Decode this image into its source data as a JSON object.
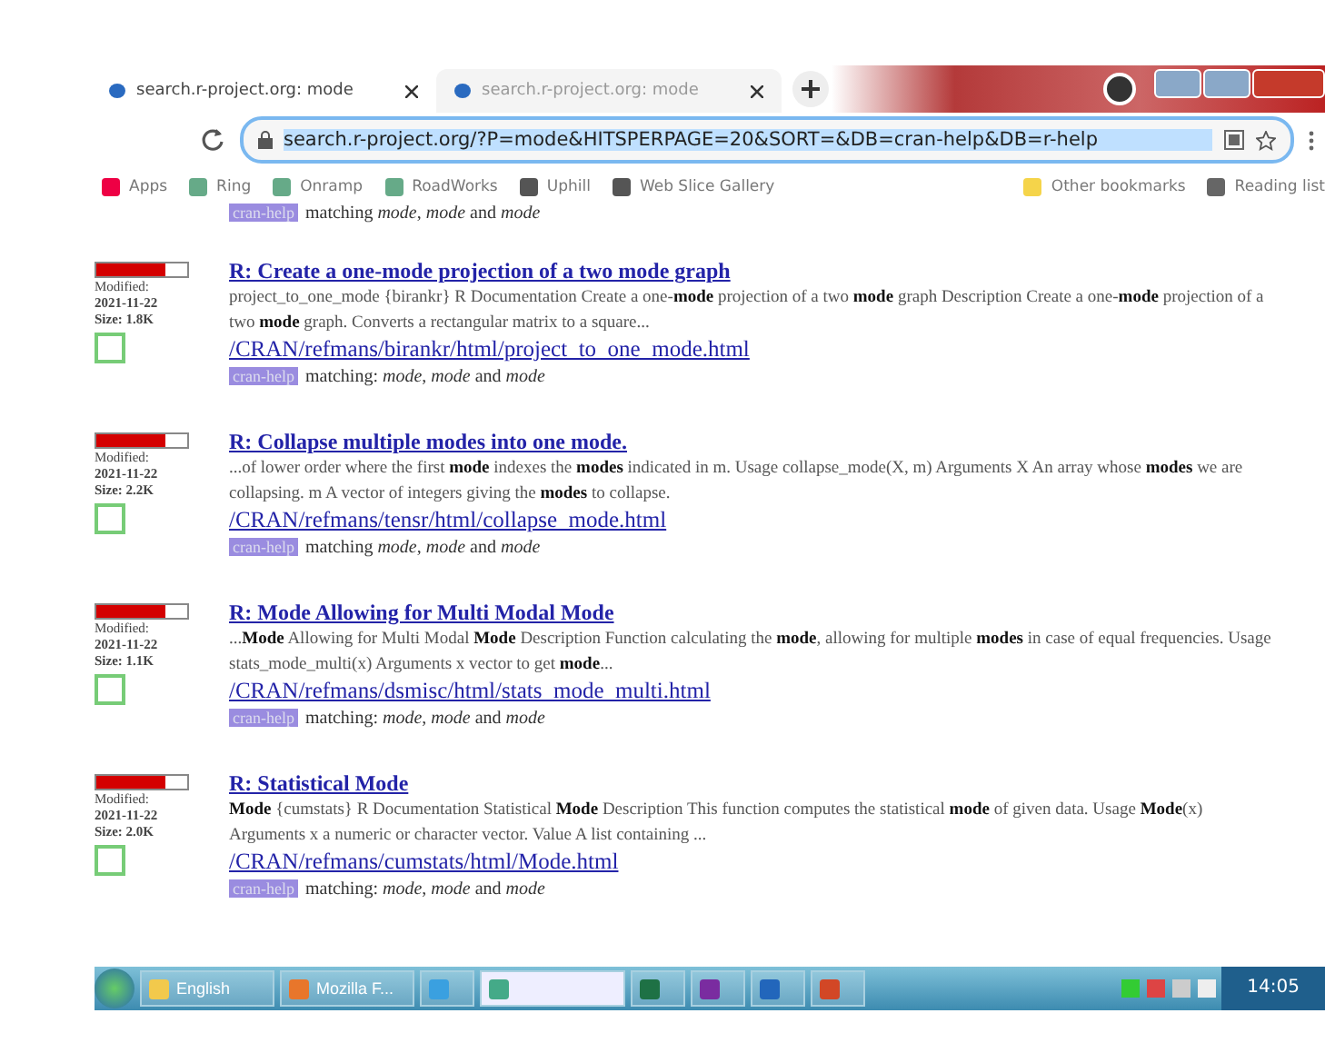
{
  "tabs": [
    {
      "title": "search.r-project.org: mode",
      "selected": true
    },
    {
      "title": "search.r-project.org: mode",
      "selected": false
    }
  ],
  "address": "search.r-project.org/?P=mode&HITSPERPAGE=20&SORT=&DB=cran-help&DB=r-help",
  "bookmarks": [
    {
      "label": "Apps",
      "kind": "apps"
    },
    {
      "label": "Ring",
      "kind": "image"
    },
    {
      "label": "Onramp",
      "kind": "image"
    },
    {
      "label": "RoadWorks",
      "kind": "image"
    },
    {
      "label": "Uphill",
      "kind": "globe"
    },
    {
      "label": "Web Slice Gallery",
      "kind": "globe"
    }
  ],
  "bookmarks_right": [
    {
      "label": "Other bookmarks",
      "kind": "folder"
    },
    {
      "label": "Reading list",
      "kind": "list"
    }
  ],
  "top_match": {
    "tag": "cran-help",
    "matching": "matching *mode*, *mode* and *mode*"
  },
  "results": [
    {
      "title": "R: Create a one-mode projection of a two mode graph",
      "snippet": "project_to_one_mode {birankr} R Documentation Create a one-**mode** projection of a two **mode** graph Description Create a one-**mode** projection of a two **mode** graph. Converts a rectangular matrix to a square...",
      "url": "/CRAN/refmans/birankr/html/project_to_one_mode.html",
      "tag": "cran-help",
      "matching": "matching: *mode*, *mode* and *mode*",
      "level": 0.75,
      "modified": "Modified:",
      "date": "2021-11-22",
      "size": "Size: 1.8K",
      "checked": false
    },
    {
      "title": "R: Collapse multiple modes into one mode.",
      "snippet": "...of lower order where the first **mode** indexes the **modes** indicated in m. Usage collapse_mode(X, m) Arguments X An array whose **modes** we are collapsing. m A vector of integers giving the **modes** to collapse.",
      "url": "/CRAN/refmans/tensr/html/collapse_mode.html",
      "tag": "cran-help",
      "matching": "matching *mode*, *mode* and *mode*",
      "level": 0.75,
      "modified": "Modified:",
      "date": "2021-11-22",
      "size": "Size: 2.2K",
      "checked": false
    },
    {
      "title": "R: Mode Allowing for Multi Modal Mode",
      "snippet": "...**Mode** Allowing for Multi Modal **Mode** Description Function calculating the **mode**, allowing for multiple **modes** in case of equal frequencies. Usage stats_mode_multi(x) Arguments x vector to get **mode**...",
      "url": "/CRAN/refmans/dsmisc/html/stats_mode_multi.html",
      "tag": "cran-help",
      "matching": "matching: *mode*, *mode* and *mode*",
      "level": 0.75,
      "modified": "Modified:",
      "date": "2021-11-22",
      "size": "Size: 1.1K",
      "checked": false
    },
    {
      "title": "R: Statistical Mode",
      "snippet": "**Mode** {cumstats} R Documentation Statistical **Mode** Description This function computes the statistical **mode** of given data. Usage **Mode**(x) Arguments x a numeric or character vector. Value A list containing ...",
      "url": "/CRAN/refmans/cumstats/html/Mode.html",
      "tag": "cran-help",
      "matching": "matching: *mode*, *mode* and *mode*",
      "level": 0.75,
      "modified": "Modified:",
      "date": "2021-11-22",
      "size": "Size: 2.0K",
      "checked": false
    }
  ],
  "taskbar": [
    {
      "label": "English",
      "kind": "folder",
      "selected": false
    },
    {
      "label": "Mozilla F...",
      "kind": "firefox",
      "selected": false
    },
    {
      "kind": "ie",
      "selected": false
    },
    {
      "kind": "chrome",
      "selected": true
    },
    {
      "kind": "excel",
      "selected": false
    },
    {
      "kind": "onenote",
      "selected": false
    },
    {
      "kind": "r",
      "selected": false
    },
    {
      "kind": "powerpoint",
      "selected": false
    }
  ],
  "clock": "14:05"
}
